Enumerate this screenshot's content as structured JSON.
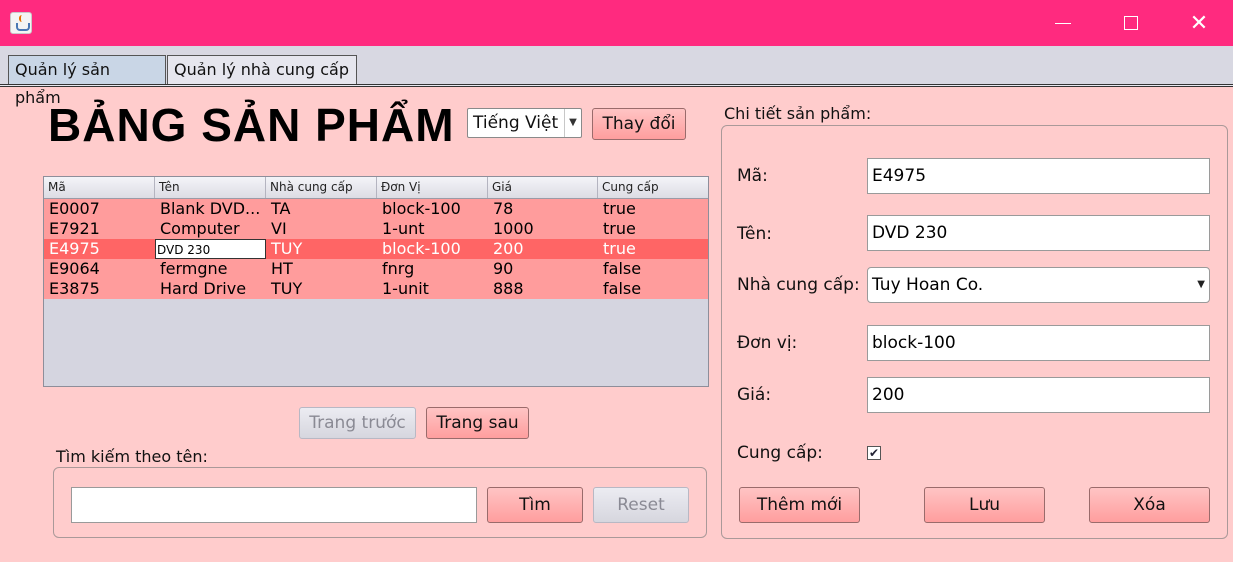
{
  "window": {
    "icon": "java-coffee-icon",
    "title_bar_color": "#ff2a7f"
  },
  "tabs": [
    {
      "label": "Quản lý sản phẩm",
      "active": true
    },
    {
      "label": "Quản lý nhà cung cấp",
      "active": false
    }
  ],
  "header": {
    "title": "BẢNG SẢN PHẨM",
    "language_select": "Tiếng Việt",
    "change_button": "Thay đổi"
  },
  "table": {
    "columns": [
      "Mã",
      "Tên",
      "Nhà cung cấp",
      "Đơn Vị",
      "Giá",
      "Cung cấp"
    ],
    "rows": [
      [
        "E0007",
        "Blank DVD...",
        "TA",
        "block-100",
        "78",
        "true"
      ],
      [
        "E7921",
        "Computer",
        "VI",
        "1-unt",
        "1000",
        "true"
      ],
      [
        "E4975",
        "DVD 230",
        "TUY",
        "block-100",
        "200",
        "true"
      ],
      [
        "E9064",
        "fermgne",
        "HT",
        "fnrg",
        "90",
        "false"
      ],
      [
        "E3875",
        "Hard Drive",
        "TUY",
        "1-unit",
        "888",
        "false"
      ]
    ],
    "selected_row": 2,
    "editing_cell": "DVD 230"
  },
  "pagination": {
    "prev_label": "Trang trước",
    "next_label": "Trang sau"
  },
  "search": {
    "label": "Tìm kiếm theo tên:",
    "value": "",
    "find_label": "Tìm",
    "reset_label": "Reset"
  },
  "detail": {
    "heading": "Chi tiết sản phẩm:",
    "code_label": "Mã:",
    "code_value": "E4975",
    "name_label": "Tên:",
    "name_value": "DVD 230",
    "supplier_label": "Nhà cung cấp:",
    "supplier_value": "Tuy Hoan Co.",
    "unit_label": "Đơn vị:",
    "unit_value": "block-100",
    "price_label": "Giá:",
    "price_value": "200",
    "supply_label": "Cung cấp:",
    "supply_checked": true,
    "add_label": "Thêm mới",
    "save_label": "Lưu",
    "delete_label": "Xóa"
  }
}
